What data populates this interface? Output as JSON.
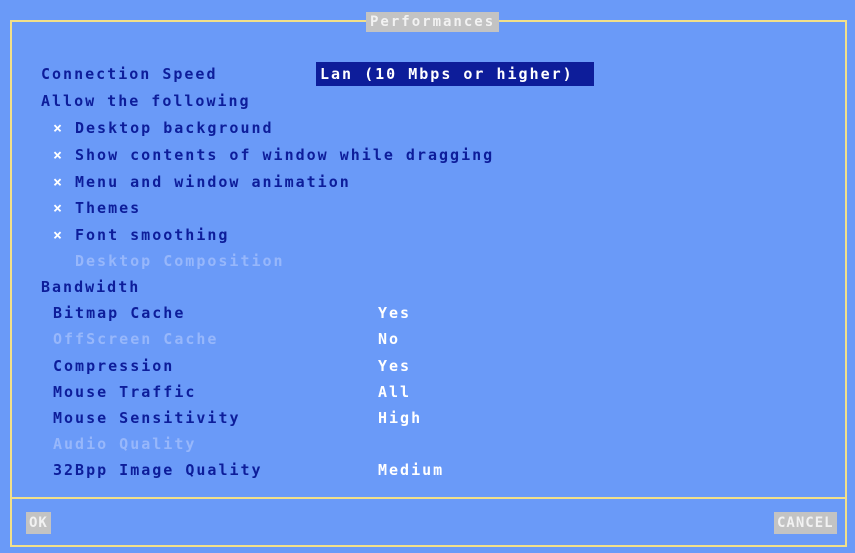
{
  "dialog": {
    "title": "Performances"
  },
  "connection": {
    "label": "Connection Speed",
    "value": "Lan (10 Mbps or higher)"
  },
  "allow": {
    "heading": "Allow the following",
    "check_glyph": "×",
    "items": [
      {
        "label": "Desktop background",
        "checked": true,
        "enabled": true
      },
      {
        "label": "Show contents of window while dragging",
        "checked": true,
        "enabled": true
      },
      {
        "label": "Menu and window animation",
        "checked": true,
        "enabled": true
      },
      {
        "label": "Themes",
        "checked": true,
        "enabled": true
      },
      {
        "label": "Font smoothing",
        "checked": true,
        "enabled": true
      },
      {
        "label": "Desktop Composition",
        "checked": false,
        "enabled": false
      }
    ]
  },
  "bandwidth": {
    "heading": "Bandwidth",
    "rows": [
      {
        "label": "Bitmap Cache",
        "value": "Yes",
        "enabled": true
      },
      {
        "label": "OffScreen Cache",
        "value": "No",
        "enabled": false
      },
      {
        "label": "Compression",
        "value": "Yes",
        "enabled": true
      },
      {
        "label": "Mouse Traffic",
        "value": "All",
        "enabled": true
      },
      {
        "label": "Mouse Sensitivity",
        "value": "High",
        "enabled": true
      },
      {
        "label": "Audio Quality",
        "value": "",
        "enabled": false
      },
      {
        "label": "32Bpp Image Quality",
        "value": "Medium",
        "enabled": true
      }
    ]
  },
  "buttons": {
    "ok": "OK",
    "cancel": "CANCEL"
  },
  "colors": {
    "background": "#6a9af8",
    "text": "#0d1d9a",
    "disabled_text": "#97b7fb",
    "value_text": "#ffffff",
    "border": "#f2e08a",
    "button_bg": "#c3c3c3"
  }
}
